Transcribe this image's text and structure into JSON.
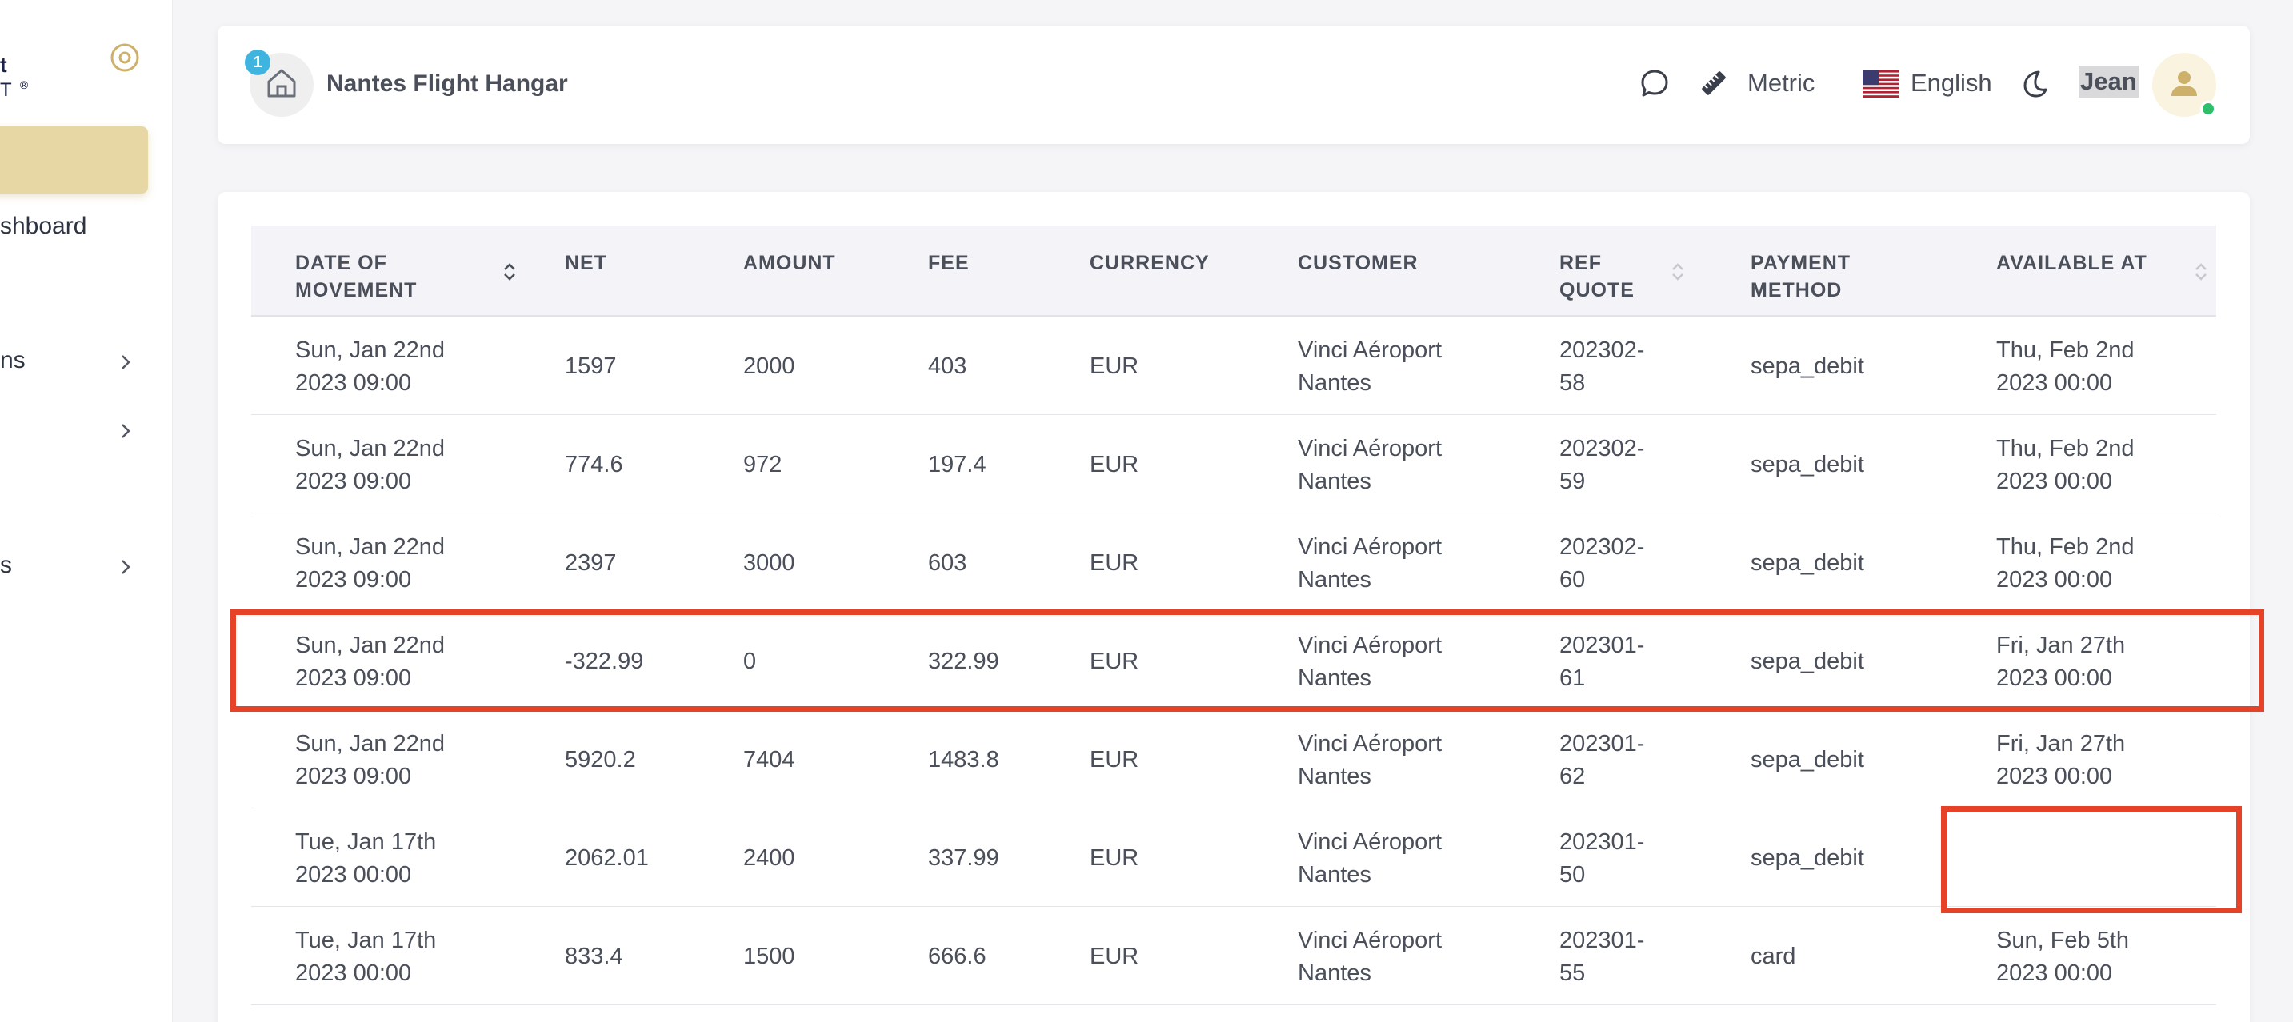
{
  "sidebar": {
    "brand_top": "t",
    "brand_bottom": "T",
    "brand_mark": "®",
    "items": [
      {
        "label": ""
      },
      {
        "label": "shboard"
      },
      {
        "label": "ns"
      },
      {
        "label": ""
      },
      {
        "label": "s"
      }
    ]
  },
  "header": {
    "notification_count": "1",
    "hangar_name": "Nantes Flight Hangar",
    "units_label": "Metric",
    "language_label": "English",
    "user_name": "Jean"
  },
  "table": {
    "columns": [
      {
        "label": "DATE OF MOVEMENT",
        "sortable": true
      },
      {
        "label": "NET",
        "sortable": false
      },
      {
        "label": "AMOUNT",
        "sortable": false
      },
      {
        "label": "FEE",
        "sortable": false
      },
      {
        "label": "CURRENCY",
        "sortable": false
      },
      {
        "label": "CUSTOMER",
        "sortable": false
      },
      {
        "label": "REF QUOTE",
        "sortable": true
      },
      {
        "label": "PAYMENT METHOD",
        "sortable": false
      },
      {
        "label": "AVAILABLE AT",
        "sortable": true
      }
    ],
    "rows": [
      {
        "date_line1": "Sun, Jan 22nd",
        "date_line2": "2023 09:00",
        "net": "1597",
        "amount": "2000",
        "fee": "403",
        "currency": "EUR",
        "customer_line1": "Vinci Aéroport",
        "customer_line2": "Nantes",
        "ref_line1": "202302-",
        "ref_line2": "58",
        "payment_method": "sepa_debit",
        "avail_line1": "Thu, Feb 2nd",
        "avail_line2": "2023 00:00"
      },
      {
        "date_line1": "Sun, Jan 22nd",
        "date_line2": "2023 09:00",
        "net": "774.6",
        "amount": "972",
        "fee": "197.4",
        "currency": "EUR",
        "customer_line1": "Vinci Aéroport",
        "customer_line2": "Nantes",
        "ref_line1": "202302-",
        "ref_line2": "59",
        "payment_method": "sepa_debit",
        "avail_line1": "Thu, Feb 2nd",
        "avail_line2": "2023 00:00"
      },
      {
        "date_line1": "Sun, Jan 22nd",
        "date_line2": "2023 09:00",
        "net": "2397",
        "amount": "3000",
        "fee": "603",
        "currency": "EUR",
        "customer_line1": "Vinci Aéroport",
        "customer_line2": "Nantes",
        "ref_line1": "202302-",
        "ref_line2": "60",
        "payment_method": "sepa_debit",
        "avail_line1": "Thu, Feb 2nd",
        "avail_line2": "2023 00:00"
      },
      {
        "date_line1": "Sun, Jan 22nd",
        "date_line2": "2023 09:00",
        "net": "-322.99",
        "amount": "0",
        "fee": "322.99",
        "currency": "EUR",
        "customer_line1": "Vinci Aéroport",
        "customer_line2": "Nantes",
        "ref_line1": "202301-",
        "ref_line2": "61",
        "payment_method": "sepa_debit",
        "avail_line1": "Fri, Jan 27th",
        "avail_line2": "2023 00:00"
      },
      {
        "date_line1": "Sun, Jan 22nd",
        "date_line2": "2023 09:00",
        "net": "5920.2",
        "amount": "7404",
        "fee": "1483.8",
        "currency": "EUR",
        "customer_line1": "Vinci Aéroport",
        "customer_line2": "Nantes",
        "ref_line1": "202301-",
        "ref_line2": "62",
        "payment_method": "sepa_debit",
        "avail_line1": "Fri, Jan 27th",
        "avail_line2": "2023 00:00"
      },
      {
        "date_line1": "Tue, Jan 17th",
        "date_line2": "2023 00:00",
        "net": "2062.01",
        "amount": "2400",
        "fee": "337.99",
        "currency": "EUR",
        "customer_line1": "Vinci Aéroport",
        "customer_line2": "Nantes",
        "ref_line1": "202301-",
        "ref_line2": "50",
        "payment_method": "sepa_debit",
        "avail_line1": "",
        "avail_line2": ""
      },
      {
        "date_line1": "Tue, Jan 17th",
        "date_line2": "2023 00:00",
        "net": "833.4",
        "amount": "1500",
        "fee": "666.6",
        "currency": "EUR",
        "customer_line1": "Vinci Aéroport",
        "customer_line2": "Nantes",
        "ref_line1": "202301-",
        "ref_line2": "55",
        "payment_method": "card",
        "avail_line1": "Sun, Feb 5th",
        "avail_line2": "2023 00:00"
      }
    ]
  },
  "icons": {
    "sidebar_toggle": "circle-dot-icon",
    "home": "home-icon",
    "chat": "chat-bubble-icon",
    "ruler": "ruler-icon",
    "flag": "us-flag-icon",
    "theme": "moon-icon",
    "avatar": "user-icon",
    "sort": "sort-arrows-icon",
    "chevron": "chevron-right-icon"
  },
  "colors": {
    "accent_gold": "#e6d7a5",
    "badge_blue": "#3fb4de",
    "online_green": "#2dbf6b",
    "annotation_red": "#e54228",
    "header_bg": "#f3f3f8"
  }
}
